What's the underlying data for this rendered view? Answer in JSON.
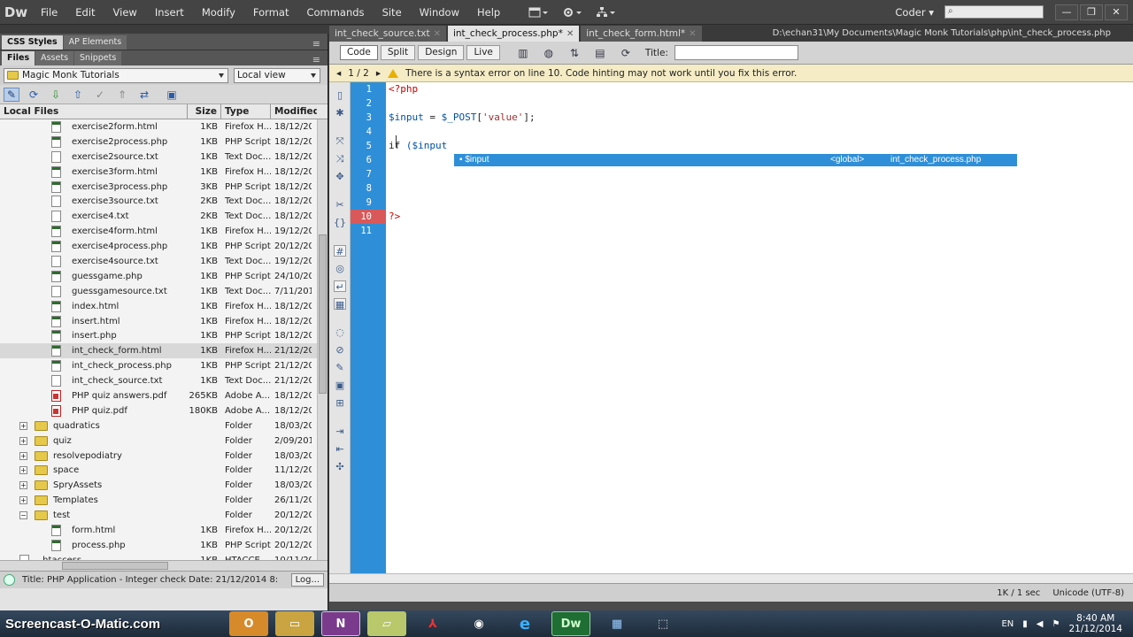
{
  "app": {
    "logo": "Dw"
  },
  "menubar": {
    "items": [
      "File",
      "Edit",
      "View",
      "Insert",
      "Modify",
      "Format",
      "Commands",
      "Site",
      "Window",
      "Help"
    ],
    "workspace": "Coder",
    "win_controls": {
      "min": "—",
      "max": "❐",
      "close": "✕"
    }
  },
  "left": {
    "top_tabs": [
      "CSS Styles",
      "AP Elements"
    ],
    "file_tabs": [
      "Files",
      "Assets",
      "Snippets"
    ],
    "site": "Magic Monk Tutorials",
    "view": "Local view",
    "columns": [
      "Local Files",
      "Size",
      "Type",
      "Modified"
    ],
    "files": [
      {
        "name": "exercise2form.html",
        "size": "1KB",
        "type": "Firefox H...",
        "mod": "18/12/20:",
        "icon": "html",
        "indent": 2
      },
      {
        "name": "exercise2process.php",
        "size": "1KB",
        "type": "PHP Script",
        "mod": "18/12/20:",
        "icon": "php",
        "indent": 2
      },
      {
        "name": "exercise2source.txt",
        "size": "1KB",
        "type": "Text Doc...",
        "mod": "18/12/20:",
        "icon": "txt",
        "indent": 2
      },
      {
        "name": "exercise3form.html",
        "size": "1KB",
        "type": "Firefox H...",
        "mod": "18/12/20:",
        "icon": "html",
        "indent": 2
      },
      {
        "name": "exercise3process.php",
        "size": "3KB",
        "type": "PHP Script",
        "mod": "18/12/20:",
        "icon": "php",
        "indent": 2
      },
      {
        "name": "exercise3source.txt",
        "size": "2KB",
        "type": "Text Doc...",
        "mod": "18/12/20:",
        "icon": "txt",
        "indent": 2
      },
      {
        "name": "exercise4.txt",
        "size": "2KB",
        "type": "Text Doc...",
        "mod": "18/12/20:",
        "icon": "txt",
        "indent": 2
      },
      {
        "name": "exercise4form.html",
        "size": "1KB",
        "type": "Firefox H...",
        "mod": "19/12/20:",
        "icon": "html",
        "indent": 2
      },
      {
        "name": "exercise4process.php",
        "size": "1KB",
        "type": "PHP Script",
        "mod": "20/12/20:",
        "icon": "php",
        "indent": 2
      },
      {
        "name": "exercise4source.txt",
        "size": "1KB",
        "type": "Text Doc...",
        "mod": "19/12/20:",
        "icon": "txt",
        "indent": 2
      },
      {
        "name": "guessgame.php",
        "size": "1KB",
        "type": "PHP Script",
        "mod": "24/10/20:",
        "icon": "php",
        "indent": 2
      },
      {
        "name": "guessgamesource.txt",
        "size": "1KB",
        "type": "Text Doc...",
        "mod": "7/11/2013",
        "icon": "txt",
        "indent": 2
      },
      {
        "name": "index.html",
        "size": "1KB",
        "type": "Firefox H...",
        "mod": "18/12/20:",
        "icon": "html",
        "indent": 2
      },
      {
        "name": "insert.html",
        "size": "1KB",
        "type": "Firefox H...",
        "mod": "18/12/20:",
        "icon": "html",
        "indent": 2
      },
      {
        "name": "insert.php",
        "size": "1KB",
        "type": "PHP Script",
        "mod": "18/12/20:",
        "icon": "php",
        "indent": 2
      },
      {
        "name": "int_check_form.html",
        "size": "1KB",
        "type": "Firefox H...",
        "mod": "21/12/20:",
        "icon": "html",
        "indent": 2,
        "selected": true
      },
      {
        "name": "int_check_process.php",
        "size": "1KB",
        "type": "PHP Script",
        "mod": "21/12/20:",
        "icon": "php",
        "indent": 2
      },
      {
        "name": "int_check_source.txt",
        "size": "1KB",
        "type": "Text Doc...",
        "mod": "21/12/20:",
        "icon": "txt",
        "indent": 2
      },
      {
        "name": "PHP quiz answers.pdf",
        "size": "265KB",
        "type": "Adobe A...",
        "mod": "18/12/20:",
        "icon": "pdf",
        "indent": 2
      },
      {
        "name": "PHP quiz.pdf",
        "size": "180KB",
        "type": "Adobe A...",
        "mod": "18/12/20:",
        "icon": "pdf",
        "indent": 2
      },
      {
        "name": "quadratics",
        "size": "",
        "type": "Folder",
        "mod": "18/03/20:",
        "icon": "folder",
        "indent": 1,
        "exp": "+"
      },
      {
        "name": "quiz",
        "size": "",
        "type": "Folder",
        "mod": "2/09/2014",
        "icon": "folder",
        "indent": 1,
        "exp": "+"
      },
      {
        "name": "resolvepodiatry",
        "size": "",
        "type": "Folder",
        "mod": "18/03/20:",
        "icon": "folder",
        "indent": 1,
        "exp": "+"
      },
      {
        "name": "space",
        "size": "",
        "type": "Folder",
        "mod": "11/12/20:",
        "icon": "folder",
        "indent": 1,
        "exp": "+"
      },
      {
        "name": "SpryAssets",
        "size": "",
        "type": "Folder",
        "mod": "18/03/20:",
        "icon": "folder",
        "indent": 1,
        "exp": "+"
      },
      {
        "name": "Templates",
        "size": "",
        "type": "Folder",
        "mod": "26/11/20:",
        "icon": "folder",
        "indent": 1,
        "exp": "+"
      },
      {
        "name": "test",
        "size": "",
        "type": "Folder",
        "mod": "20/12/20:",
        "icon": "folder",
        "indent": 1,
        "exp": "−"
      },
      {
        "name": "form.html",
        "size": "1KB",
        "type": "Firefox H...",
        "mod": "20/12/20:",
        "icon": "html",
        "indent": 2
      },
      {
        "name": "process.php",
        "size": "1KB",
        "type": "PHP Script",
        "mod": "20/12/20:",
        "icon": "php",
        "indent": 2
      },
      {
        "name": ".htaccess",
        "size": "1KB",
        "type": "HTACCE...",
        "mod": "10/11/20:",
        "icon": "txt",
        "indent": 1
      }
    ],
    "status": "Title: PHP Application - Integer check  Date: 21/12/2014 8:",
    "log_button": "Log..."
  },
  "doc": {
    "tabs": [
      {
        "label": "int_check_source.txt",
        "active": false
      },
      {
        "label": "int_check_process.php*",
        "active": true
      },
      {
        "label": "int_check_form.html*",
        "active": false
      }
    ],
    "path": "D:\\echan31\\My Documents\\Magic Monk Tutorials\\php\\int_check_process.php",
    "views": [
      "Code",
      "Split",
      "Design",
      "Live"
    ],
    "title_label": "Title:",
    "info": {
      "counter": "1 / 2",
      "message": "There is a syntax error on line 10.  Code hinting may not work until you fix this error."
    },
    "line_numbers": [
      "1",
      "2",
      "3",
      "4",
      "5",
      "6",
      "7",
      "8",
      "9",
      "10",
      "11"
    ],
    "error_line": "10",
    "code": {
      "l1": "<?php",
      "l3_var": "$input",
      "l3_op": " = ",
      "l3_post": "$_POST",
      "l3_open": "[",
      "l3_str": "'value'",
      "l3_close": "];",
      "l5_kw": "if",
      "l5_rest": " ($input",
      "l10": "?>"
    },
    "hint": {
      "var": "$input",
      "scope": "<global>",
      "file": "int_check_process.php"
    },
    "status": {
      "size": "1K / 1 sec",
      "encoding": "Unicode (UTF-8)"
    }
  },
  "taskbar": {
    "brand": "Screencast-O-Matic.com",
    "lang": "EN",
    "time": "8:40 AM",
    "date": "21/12/2014"
  }
}
